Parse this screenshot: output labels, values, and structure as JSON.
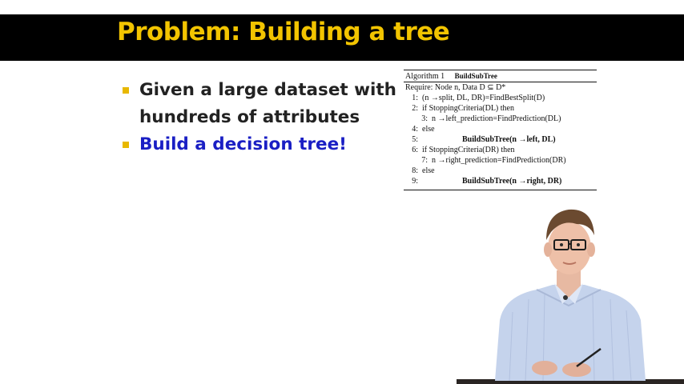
{
  "slide": {
    "title": "Problem: Building a tree",
    "bullets": [
      {
        "line1": "Given a large dataset with",
        "line2": "hundreds of attributes"
      },
      {
        "line1": "Build a decision tree!"
      }
    ]
  },
  "algorithm": {
    "label": "Algorithm 1",
    "name": "BuildSubTree",
    "require": "Require: Node n, Data D ⊆ D*",
    "lines": [
      {
        "num": "1:",
        "text": "(n →split, DL, DR)=FindBestSplit(D)"
      },
      {
        "num": "2:",
        "text": "if StoppingCriteria(DL) then"
      },
      {
        "num": "3:",
        "text": "n →left_prediction=FindPrediction(DL)"
      },
      {
        "num": "4:",
        "text": "else"
      },
      {
        "num": "5:",
        "text": "BuildSubTree(n →left, DL)"
      },
      {
        "num": "6:",
        "text": "if StoppingCriteria(DR) then"
      },
      {
        "num": "7:",
        "text": "n →right_prediction=FindPrediction(DR)"
      },
      {
        "num": "8:",
        "text": "else"
      },
      {
        "num": "9:",
        "text": "BuildSubTree(n →right, DR)"
      }
    ]
  },
  "colors": {
    "title": "#f2c400",
    "title_bar": "#000000",
    "bullet_marker": "#e8b800",
    "highlight_text": "#1a1fc4"
  }
}
